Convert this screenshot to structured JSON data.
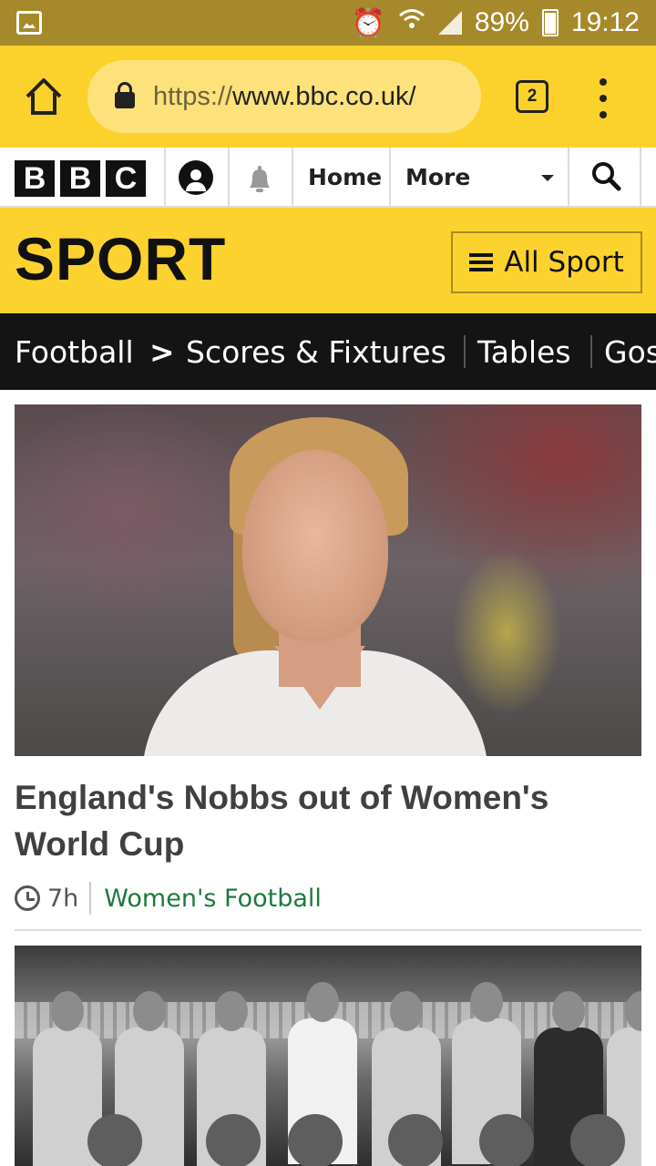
{
  "status_bar": {
    "battery": "89%",
    "time": "19:12",
    "icons": [
      "gallery-icon",
      "alarm-icon",
      "wifi-icon",
      "signal-icon",
      "battery-icon"
    ]
  },
  "browser": {
    "url_scheme": "https://",
    "url_host": "www.bbc.co.uk/",
    "tab_count": "2",
    "accent_color": "#fbd22b"
  },
  "bbc_nav": {
    "logo_letters": [
      "B",
      "B",
      "C"
    ],
    "links": {
      "home": "Home",
      "more": "More"
    }
  },
  "sport_header": {
    "title": "SPORT",
    "all_sport_label": "All Sport"
  },
  "football_nav": {
    "section": "Football",
    "chevron": ">",
    "items": [
      "Scores & Fixtures",
      "Tables",
      "Gos"
    ]
  },
  "stories": [
    {
      "headline": "England's Nobbs out of Women's World Cup",
      "time": "7h",
      "tag": "Women's Football"
    }
  ]
}
